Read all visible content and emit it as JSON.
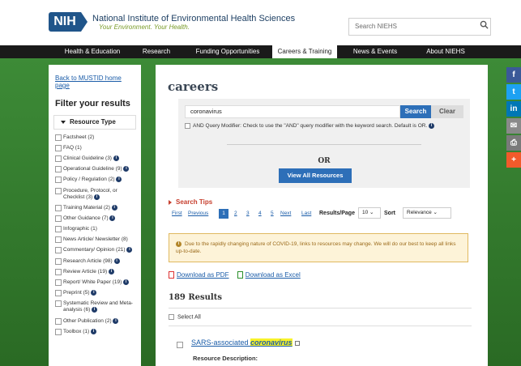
{
  "header": {
    "logo": "NIH",
    "org_name": "National Institute of Environmental Health Sciences",
    "tagline": "Your Environment. Your Health.",
    "search_placeholder": "Search NIEHS"
  },
  "nav": {
    "items": [
      "Health & Education",
      "Research",
      "Funding Opportunities",
      "Careers & Training",
      "News & Events",
      "About NIEHS"
    ]
  },
  "sidebar": {
    "back_link": "Back to MUSTID home page",
    "filter_title": "Filter your results",
    "resource_type": "Resource Type",
    "items": [
      "Factsheet (2)",
      "FAQ (1)",
      "Clinical Guideline (3)",
      "Operational Guideline (9)",
      "Policy / Regulation (2)",
      "Procedure, Protocol, or Checklist (3)",
      "Training Material (2)",
      "Other Guidance (7)",
      "Infographic (1)",
      "News Article/ Newsletter (8)",
      "Commentary/ Opinion (21)",
      "Research Article (98)",
      "Review Article (19)",
      "Report/ White Paper (19)",
      "Preprint (5)",
      "Systematic Review and Meta-analysis (6)",
      "Other Publication (2)",
      "Toolbox (1)"
    ]
  },
  "main": {
    "title": "careers",
    "keyword": "coronavirus",
    "search_btn": "Search",
    "clear_btn": "Clear",
    "and_text": "AND Query Modifier: Check to use the \"AND\" query modifier with the keyword search. Default is OR.",
    "or_text": "OR",
    "view_all": "View All Resources",
    "search_tips": "Search Tips",
    "pager": {
      "first": "First",
      "previous": "Previous",
      "pages": [
        "1",
        "2",
        "3",
        "4",
        "5"
      ],
      "next": "Next",
      "last": "Last"
    },
    "results_per_page_label": "Results/Page",
    "results_per_page": "10",
    "sort_label": "Sort",
    "sort_value": "Relevance",
    "alert": "Due to the rapidly changing nature of COVID-19, links to resources may change. We will do our best to keep all links up-to-date.",
    "download_pdf": "Download as PDF",
    "download_excel": "Download as Excel",
    "results_count": "189 Results",
    "select_all": "Select All",
    "result_title_prefix": "SARS-associated ",
    "result_title_highlight": "coronavirus",
    "resource_description": "Resource Description:"
  },
  "social": {
    "items": [
      "facebook-icon",
      "twitter-icon",
      "linkedin-icon",
      "email-icon",
      "print-icon",
      "share-icon"
    ]
  },
  "colors": {
    "nav_bg": "#1a1a1a",
    "accent_blue": "#2d6fb8",
    "green": "#3d8b37",
    "alert_bg": "#fdf3d8",
    "highlight": "#f7f22a"
  }
}
